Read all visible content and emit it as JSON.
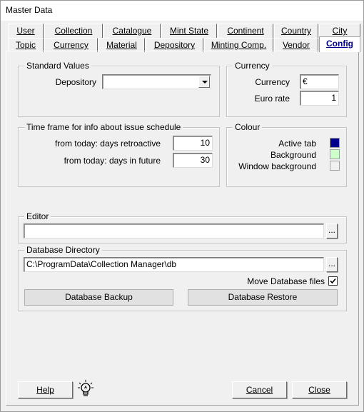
{
  "window": {
    "title": "Master Data"
  },
  "tabs": {
    "row1": [
      {
        "label": "User"
      },
      {
        "label": "Collection"
      },
      {
        "label": "Catalogue"
      },
      {
        "label": "Mint State"
      },
      {
        "label": "Continent"
      },
      {
        "label": "Country"
      },
      {
        "label": "City"
      }
    ],
    "row2": [
      {
        "label": "Topic"
      },
      {
        "label": "Currency"
      },
      {
        "label": "Material"
      },
      {
        "label": "Depository"
      },
      {
        "label": "Minting Comp."
      },
      {
        "label": "Vendor"
      },
      {
        "label": "Config",
        "active": true
      }
    ]
  },
  "standard_values": {
    "title": "Standard Values",
    "depository_label": "Depository",
    "depository_value": ""
  },
  "currency": {
    "title": "Currency",
    "currency_label": "Currency",
    "currency_value": "€",
    "euro_rate_label": "Euro rate",
    "euro_rate_value": "1"
  },
  "timeframe": {
    "title": "Time frame for info about issue schedule",
    "retro_label": "from today: days retroactive",
    "retro_value": "10",
    "future_label": "from today: days in future",
    "future_value": "30"
  },
  "colour": {
    "title": "Colour",
    "items": [
      {
        "label": "Active tab",
        "color": "#00008b"
      },
      {
        "label": "Background",
        "color": "#ccffcc"
      },
      {
        "label": "Window background",
        "color": "#f0f0f0"
      }
    ]
  },
  "editor": {
    "title": "Editor",
    "value": "",
    "browse_label": "..."
  },
  "database": {
    "title": "Database Directory",
    "path": "C:\\ProgramData\\Collection Manager\\db",
    "browse_label": "...",
    "move_label": "Move Database files",
    "move_checked": true,
    "backup_label": "Database Backup",
    "restore_label": "Database Restore"
  },
  "footer": {
    "help_label": "Help",
    "cancel_label": "Cancel",
    "close_label": "Close"
  }
}
